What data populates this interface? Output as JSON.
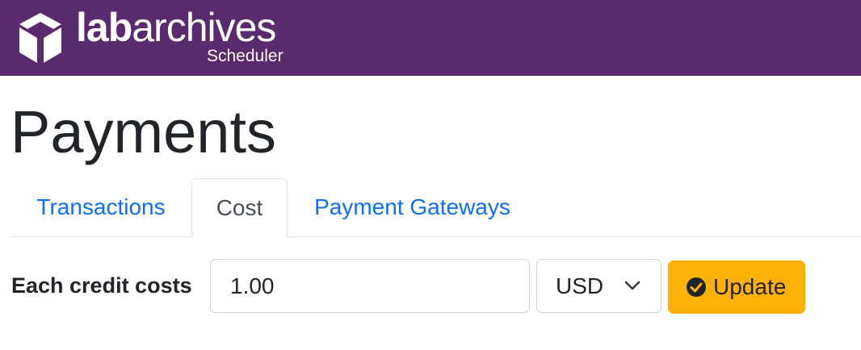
{
  "header": {
    "brand_lab": "lab",
    "brand_archives": "archives",
    "brand_sub": "Scheduler",
    "logo_icon": "labarchives-cube-icon",
    "background_color": "#5a2a6e"
  },
  "page": {
    "title": "Payments"
  },
  "tabs": [
    {
      "label": "Transactions",
      "active": false
    },
    {
      "label": "Cost",
      "active": true
    },
    {
      "label": "Payment Gateways",
      "active": false
    }
  ],
  "cost_form": {
    "label": "Each credit costs",
    "credit_cost_value": "1.00",
    "currency_selected": "USD",
    "update_label": "Update",
    "update_icon": "check-circle-icon",
    "accent_color": "#ffb10a",
    "link_color": "#0d6efd"
  }
}
